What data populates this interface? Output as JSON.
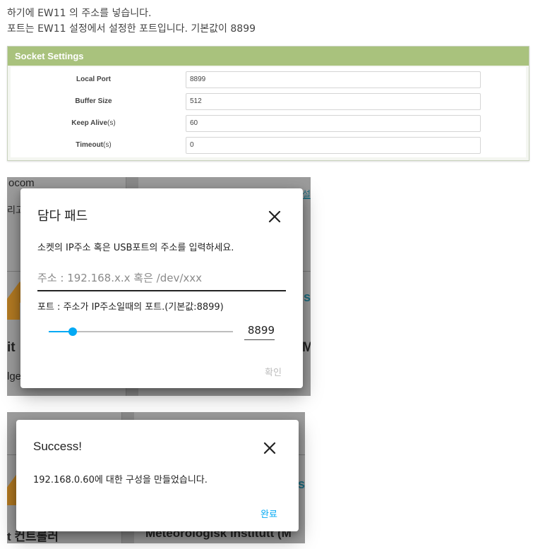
{
  "intro": {
    "line1": "하기에 EW11 의 주소를 넣습니다.",
    "line2": "포트는 EW11 설정에서 설정한 포트입니다. 기본값이 8899"
  },
  "socket_settings": {
    "title": "Socket Settings",
    "accent_color": "#a9c27d",
    "rows": [
      {
        "label": "Local Port",
        "unit": "",
        "value": "8899"
      },
      {
        "label": "Buffer Size",
        "unit": "",
        "value": "512"
      },
      {
        "label": "Keep Alive",
        "unit": "(s)",
        "value": "60"
      },
      {
        "label": "Timeout",
        "unit": "(s)",
        "value": "0"
      }
    ]
  },
  "background1": {
    "frag_ocom": "ocom",
    "frag_ri": "리고",
    "frag_it": "it",
    "frag_ge": "lge",
    "frag_s": "s",
    "frag_m": "M",
    "frag_link": "설"
  },
  "background2": {
    "frag_bottom_left": "t 컨트롤러",
    "frag_bottom_right": "Meteorologisk institutt (M",
    "frag_s": "s"
  },
  "dimda_dialog": {
    "title": "담다 패드",
    "description": "소켓의 IP주소 혹은 USB포트의 주소를 입력하세요.",
    "address_placeholder": "주소 : 192.168.x.x 혹은 /dev/xxx",
    "port_helper": "포트 : 주소가 IP주소일때의 포트.(기본값:8899)",
    "port_value": "8899",
    "slider_fraction": 0.13,
    "confirm_label": "확인",
    "close_icon": "close-icon",
    "accent_color": "#03a9f4"
  },
  "success_dialog": {
    "title": "Success!",
    "message": "192.168.0.60에 대한 구성을 만들었습니다.",
    "done_label": "완료",
    "close_icon": "close-icon"
  }
}
